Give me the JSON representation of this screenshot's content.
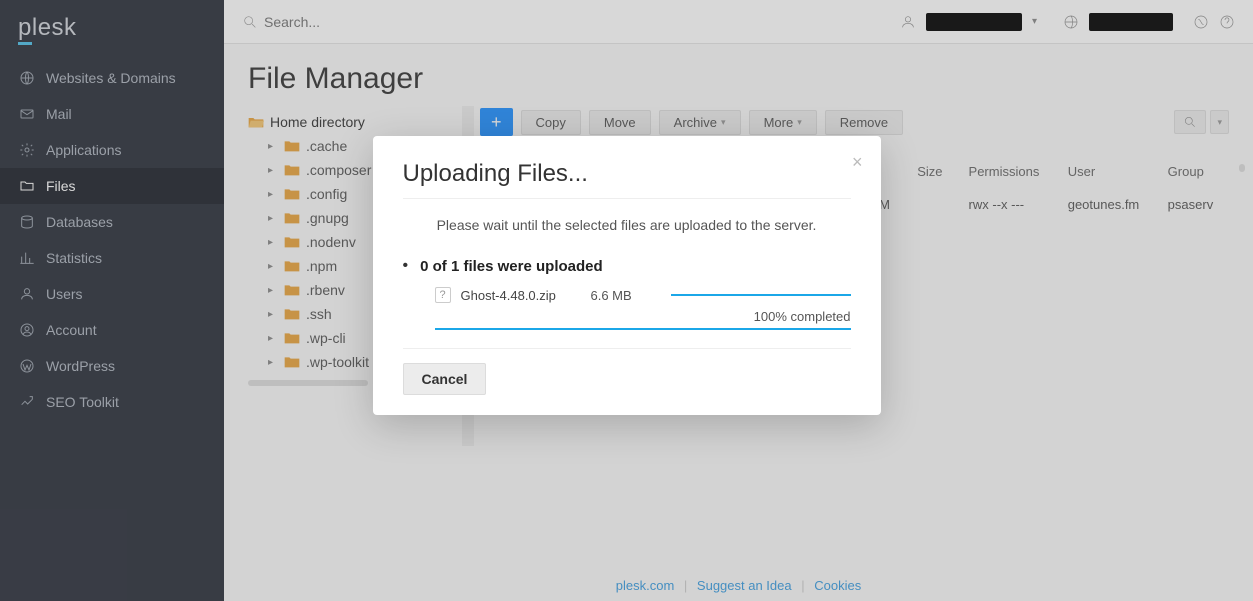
{
  "brand": "plesk",
  "search": {
    "placeholder": "Search..."
  },
  "nav": [
    {
      "label": "Websites & Domains",
      "icon": "globe"
    },
    {
      "label": "Mail",
      "icon": "mail"
    },
    {
      "label": "Applications",
      "icon": "gear"
    },
    {
      "label": "Files",
      "icon": "folder",
      "active": true
    },
    {
      "label": "Databases",
      "icon": "db"
    },
    {
      "label": "Statistics",
      "icon": "stats"
    },
    {
      "label": "Users",
      "icon": "user"
    },
    {
      "label": "Account",
      "icon": "account"
    },
    {
      "label": "WordPress",
      "icon": "wp"
    },
    {
      "label": "SEO Toolkit",
      "icon": "seo"
    }
  ],
  "page_title": "File Manager",
  "tree": {
    "root": "Home directory",
    "children": [
      ".cache",
      ".composer",
      ".config",
      ".gnupg",
      ".nodenv",
      ".npm",
      ".rbenv",
      ".ssh",
      ".wp-cli",
      ".wp-toolkit"
    ]
  },
  "toolbar": {
    "copy": "Copy",
    "move": "Move",
    "archive": "Archive",
    "more": "More",
    "remove": "Remove"
  },
  "table": {
    "headers": {
      "size": "Size",
      "permissions": "Permissions",
      "user": "User",
      "group": "Group",
      "modified_suffix": "AM"
    },
    "rows": [
      {
        "perm": "rwx --x ---",
        "user": "geotunes.fm",
        "group": "psaserv"
      }
    ]
  },
  "footer": {
    "plesk": "plesk.com",
    "suggest": "Suggest an Idea",
    "cookies": "Cookies"
  },
  "modal": {
    "title": "Uploading Files...",
    "message": "Please wait until the selected files are uploaded to the server.",
    "status": "0 of 1 files were uploaded",
    "file_name": "Ghost-4.48.0.zip",
    "file_size": "6.6 MB",
    "percent": "100% completed",
    "cancel": "Cancel"
  }
}
